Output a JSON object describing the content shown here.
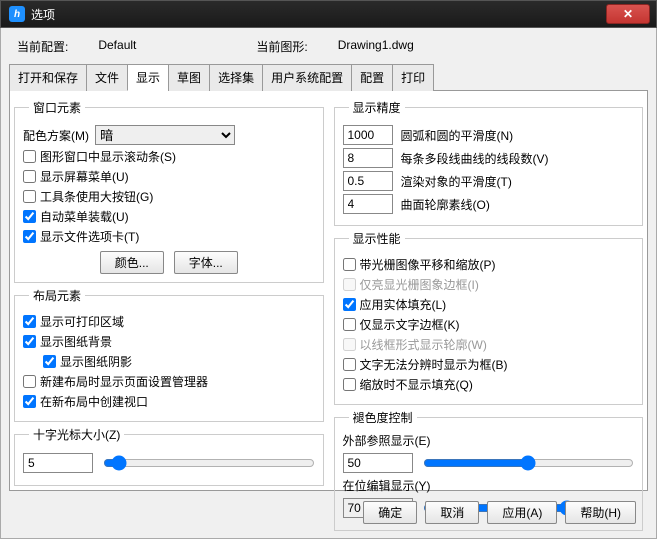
{
  "titlebar": {
    "title": "选项"
  },
  "config": {
    "current_config_label": "当前配置:",
    "current_config_value": "Default",
    "current_drawing_label": "当前图形:",
    "current_drawing_value": "Drawing1.dwg"
  },
  "tabs": [
    "打开和保存",
    "文件",
    "显示",
    "草图",
    "选择集",
    "用户系统配置",
    "配置",
    "打印"
  ],
  "left": {
    "window_elements": {
      "legend": "窗口元素",
      "color_scheme_label": "配色方案(M)",
      "color_scheme_value": "暗",
      "scrollbar": "图形窗口中显示滚动条(S)",
      "screen_menu": "显示屏幕菜单(U)",
      "large_buttons": "工具条使用大按钮(G)",
      "auto_menu": "自动菜单装载(U)",
      "file_tabs": "显示文件选项卡(T)",
      "color_btn": "颜色...",
      "font_btn": "字体..."
    },
    "layout_elements": {
      "legend": "布局元素",
      "print_area": "显示可打印区域",
      "paper_bg": "显示图纸背景",
      "paper_shadow": "显示图纸阴影",
      "page_setup": "新建布局时显示页面设置管理器",
      "viewport": "在新布局中创建视口"
    },
    "crosshair": {
      "legend": "十字光标大小(Z)",
      "value": "5"
    }
  },
  "right": {
    "precision": {
      "legend": "显示精度",
      "arc_val": "1000",
      "arc_label": "圆弧和圆的平滑度(N)",
      "seg_val": "8",
      "seg_label": "每条多段线曲线的线段数(V)",
      "render_val": "0.5",
      "render_label": "渲染对象的平滑度(T)",
      "surf_val": "4",
      "surf_label": "曲面轮廓素线(O)"
    },
    "performance": {
      "legend": "显示性能",
      "pan_raster": "带光栅图像平移和缩放(P)",
      "raster_frame": "仅亮显光栅图象边框(I)",
      "solid_fill": "应用实体填充(L)",
      "text_frame": "仅显示文字边框(K)",
      "wireframe": "以线框形式显示轮廓(W)",
      "text_block": "文字无法分辨时显示为框(B)",
      "zoom_fill": "缩放时不显示填充(Q)"
    },
    "fade": {
      "legend": "褪色度控制",
      "xref_label": "外部参照显示(E)",
      "xref_val": "50",
      "inplace_label": "在位编辑显示(Y)",
      "inplace_val": "70"
    }
  },
  "footer": {
    "ok": "确定",
    "cancel": "取消",
    "apply": "应用(A)",
    "help": "帮助(H)"
  }
}
